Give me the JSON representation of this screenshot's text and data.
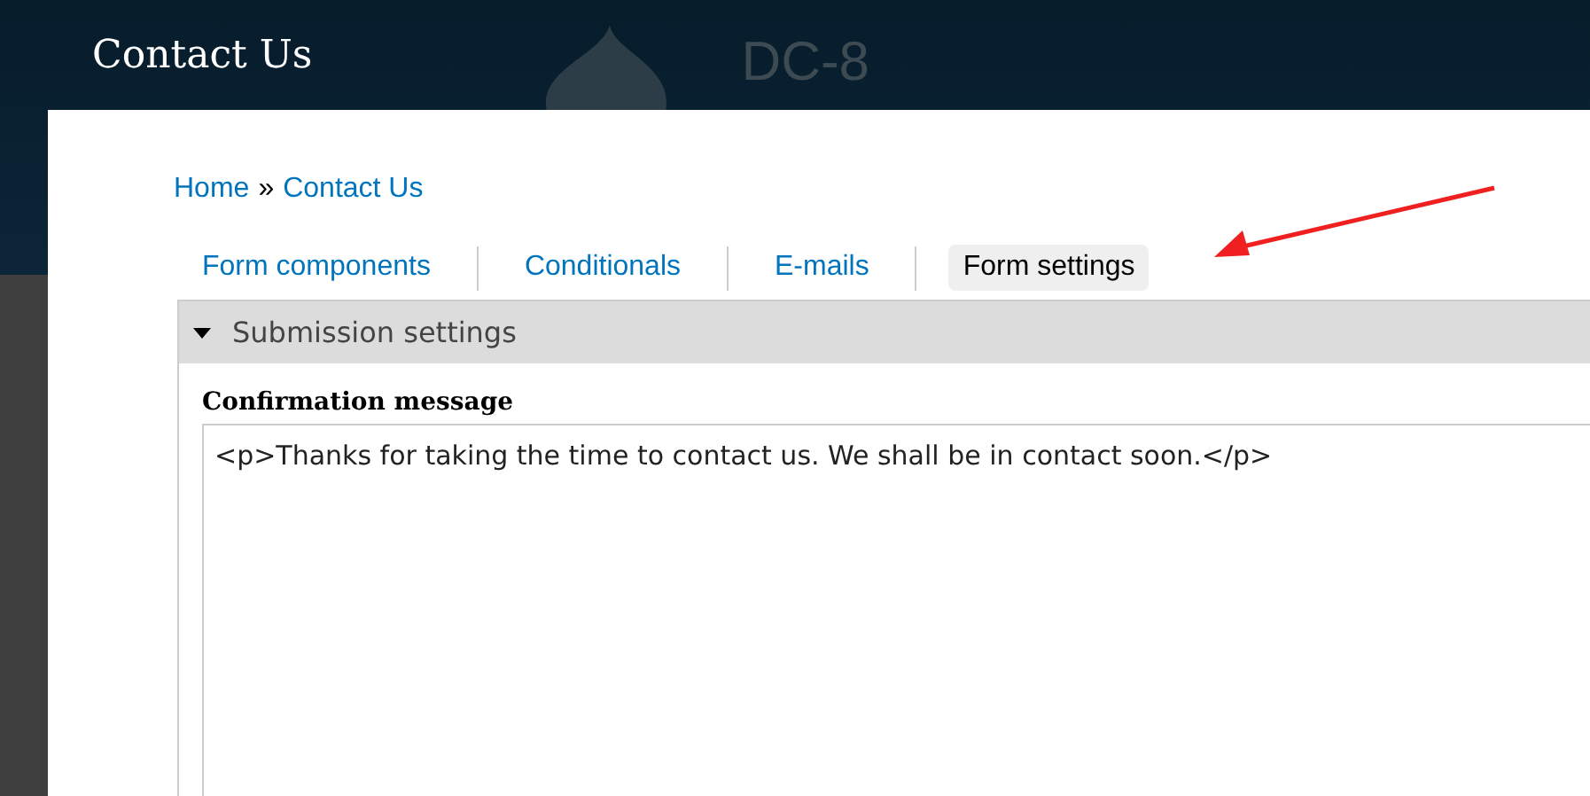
{
  "header": {
    "title": "Contact Us",
    "logo_text": "DC-8"
  },
  "breadcrumb": {
    "links": [
      "Home",
      "Contact Us"
    ],
    "separator": "»"
  },
  "tabs": [
    {
      "label": "Form components",
      "selected": false
    },
    {
      "label": "Conditionals",
      "selected": false
    },
    {
      "label": "E-mails",
      "selected": false
    },
    {
      "label": "Form settings",
      "selected": true
    }
  ],
  "fieldset": {
    "legend": "Submission settings",
    "expanded": true,
    "field": {
      "label": "Confirmation message",
      "value": "<p>Thanks for taking the time to contact us. We shall be in contact soon.</p>"
    }
  }
}
